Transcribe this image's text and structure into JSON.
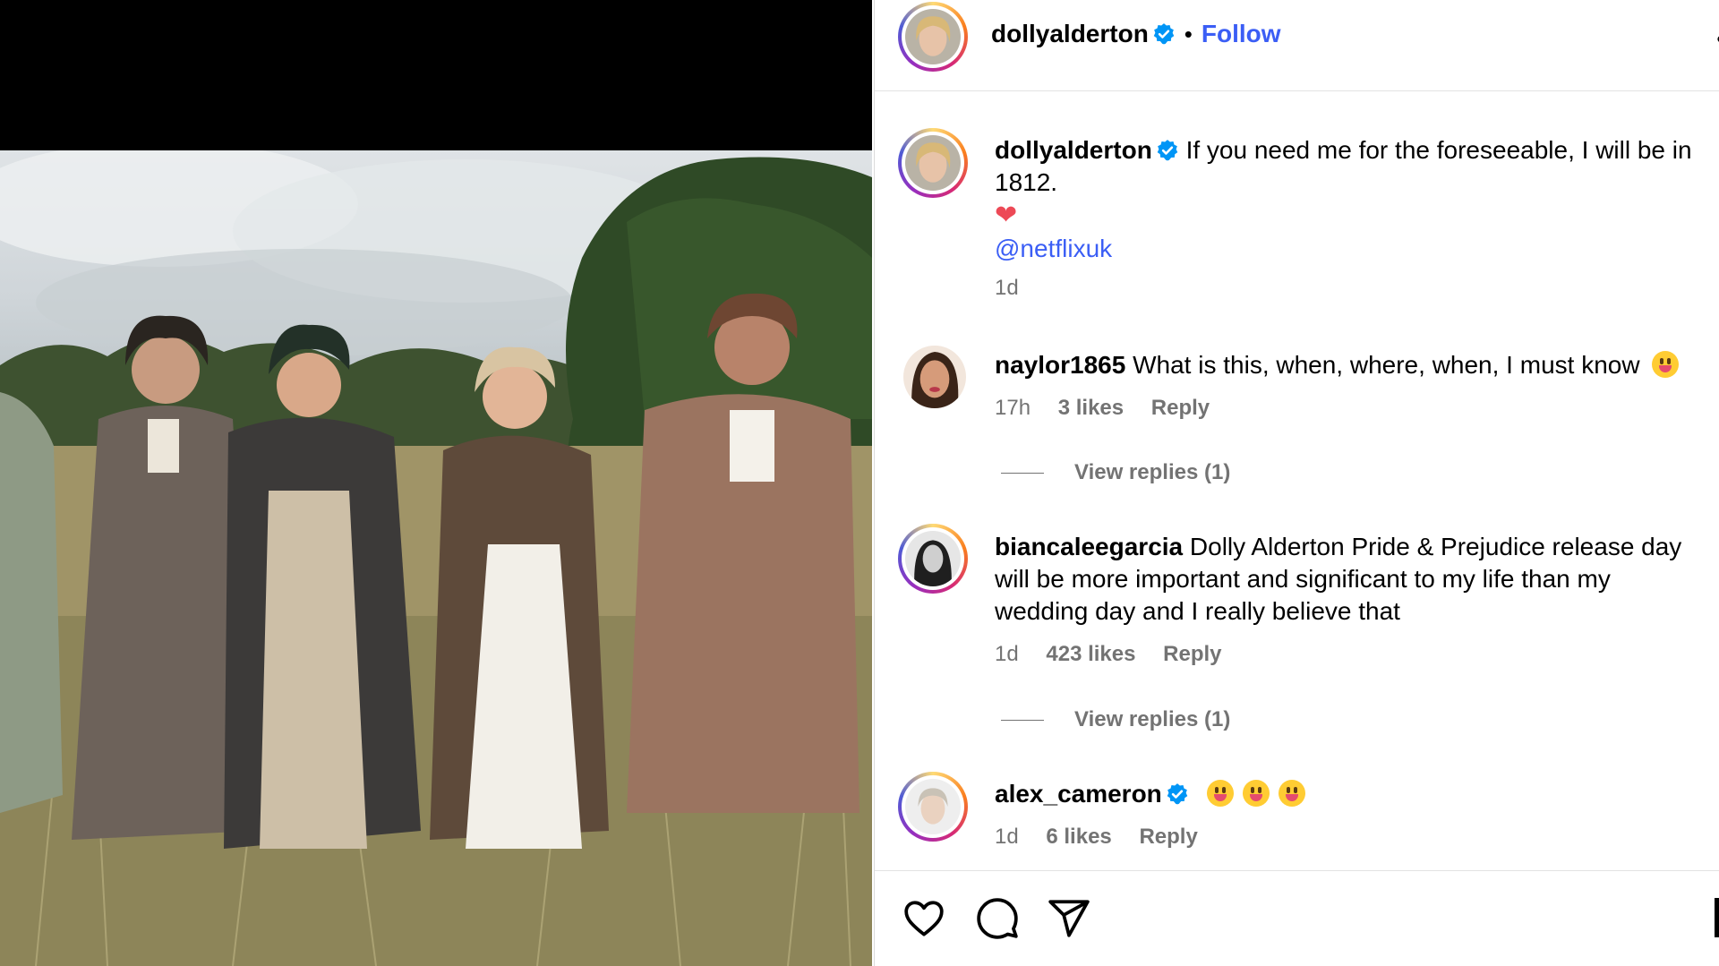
{
  "post_author": {
    "username": "dollyalderton",
    "follow_label": "Follow",
    "separator": "•",
    "more_label": "•"
  },
  "caption": {
    "username": "dollyalderton",
    "text": "If you need me for the foreseeable, I will be in 1812.",
    "emoji": "❤",
    "mention": "@netflixuk",
    "time": "1d"
  },
  "comments": [
    {
      "username": "naylor1865",
      "text": "What is this, when, where, when, I must know",
      "time": "17h",
      "likes": "3 likes",
      "reply_label": "Reply",
      "view_replies": "View replies (1)"
    },
    {
      "username": "biancaleegarcia",
      "text": "Dolly Alderton Pride & Prejudice release day will be more important and significant to my life than my wedding day and I really believe that",
      "time": "1d",
      "likes": "423 likes",
      "reply_label": "Reply",
      "view_replies": "View replies (1)"
    },
    {
      "username": "alex_cameron",
      "text": "",
      "time": "1d",
      "likes": "6 likes",
      "reply_label": "Reply"
    }
  ],
  "actions": {
    "like_icon": "heart-icon",
    "comment_icon": "comment-icon",
    "share_icon": "send-icon"
  },
  "colors": {
    "link_blue": "#3b5ef5",
    "verified_blue": "#0095f6",
    "meta_gray": "#737373",
    "heart_red": "#ed4956"
  }
}
